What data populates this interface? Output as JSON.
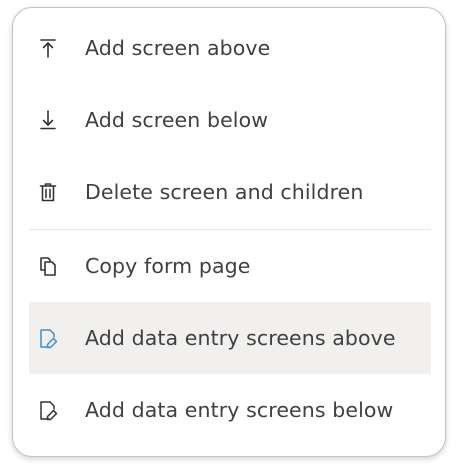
{
  "menu": {
    "items": [
      {
        "label": "Add screen above",
        "icon": "arrow-up-to-line-icon"
      },
      {
        "label": "Add screen below",
        "icon": "arrow-down-to-line-icon"
      },
      {
        "label": "Delete screen and children",
        "icon": "trash-icon"
      },
      {
        "label": "Copy form page",
        "icon": "copy-icon"
      },
      {
        "label": "Add data entry screens above",
        "icon": "edit-document-icon"
      },
      {
        "label": "Add data entry screens below",
        "icon": "edit-document-icon"
      }
    ],
    "hovered_index": 4,
    "colors": {
      "text": "#404040",
      "icon": "#333333",
      "hover_icon": "#3d8fc6",
      "hover_bg": "#f1f0ef",
      "border": "#c4c4c4"
    }
  }
}
